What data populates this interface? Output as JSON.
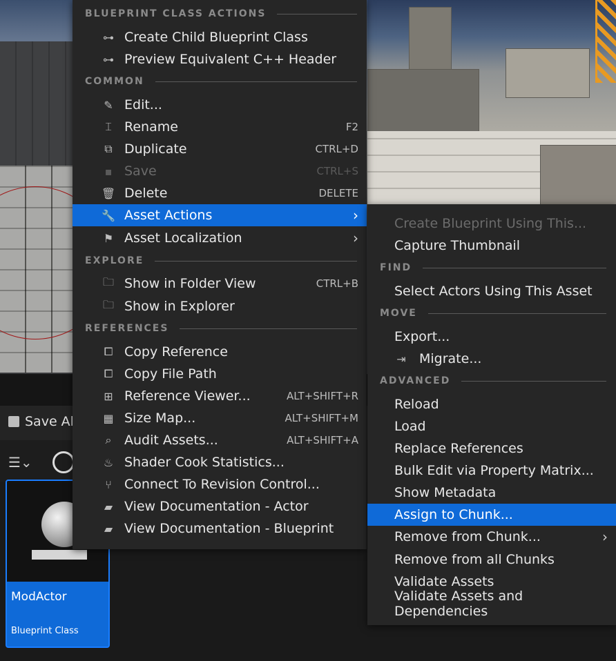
{
  "main_menu": {
    "sections": [
      {
        "title": "BLUEPRINT CLASS ACTIONS"
      },
      {
        "title": "COMMON"
      },
      {
        "title": "EXPLORE"
      },
      {
        "title": "REFERENCES"
      }
    ],
    "items": [
      {
        "label": "Create Child Blueprint Class",
        "shortcut": "",
        "icon": "blueprint-hierarchy-icon"
      },
      {
        "label": "Preview Equivalent C++ Header",
        "shortcut": "",
        "icon": "cpp-header-icon"
      },
      {
        "label": "Edit...",
        "shortcut": "",
        "icon": "pencil-icon"
      },
      {
        "label": "Rename",
        "shortcut": "F2",
        "icon": "rename-icon"
      },
      {
        "label": "Duplicate",
        "shortcut": "CTRL+D",
        "icon": "duplicate-icon"
      },
      {
        "label": "Save",
        "shortcut": "CTRL+S",
        "icon": "save-icon"
      },
      {
        "label": "Delete",
        "shortcut": "DELETE",
        "icon": "trash-icon"
      },
      {
        "label": "Asset Actions",
        "shortcut": "",
        "icon": "wrench-icon"
      },
      {
        "label": "Asset Localization",
        "shortcut": "",
        "icon": "flag-icon"
      },
      {
        "label": "Show in Folder View",
        "shortcut": "CTRL+B",
        "icon": "folder-search-icon"
      },
      {
        "label": "Show in Explorer",
        "shortcut": "",
        "icon": "folder-search-icon"
      },
      {
        "label": "Copy Reference",
        "shortcut": "",
        "icon": "copy-icon"
      },
      {
        "label": "Copy File Path",
        "shortcut": "",
        "icon": "copy-icon"
      },
      {
        "label": "Reference Viewer...",
        "shortcut": "ALT+SHIFT+R",
        "icon": "reference-viewer-icon"
      },
      {
        "label": "Size Map...",
        "shortcut": "ALT+SHIFT+M",
        "icon": "size-map-icon"
      },
      {
        "label": "Audit Assets...",
        "shortcut": "ALT+SHIFT+A",
        "icon": "audit-icon"
      },
      {
        "label": "Shader Cook Statistics...",
        "shortcut": "",
        "icon": "steam-icon"
      },
      {
        "label": "Connect To Revision Control...",
        "shortcut": "",
        "icon": "branch-icon"
      },
      {
        "label": "View Documentation - Actor",
        "shortcut": "",
        "icon": "book-icon"
      },
      {
        "label": "View Documentation - Blueprint",
        "shortcut": "",
        "icon": "book-icon"
      }
    ]
  },
  "sub_menu": {
    "sections": [
      {
        "title": "FIND"
      },
      {
        "title": "MOVE"
      },
      {
        "title": "ADVANCED"
      }
    ],
    "items": [
      {
        "label": "Create Blueprint Using This..."
      },
      {
        "label": "Capture Thumbnail"
      },
      {
        "label": "Select Actors Using This Asset"
      },
      {
        "label": "Export..."
      },
      {
        "label": "Migrate...",
        "icon": "migrate-icon"
      },
      {
        "label": "Reload"
      },
      {
        "label": "Load"
      },
      {
        "label": "Replace References"
      },
      {
        "label": "Bulk Edit via Property Matrix..."
      },
      {
        "label": "Show Metadata"
      },
      {
        "label": "Assign to Chunk..."
      },
      {
        "label": "Remove from Chunk..."
      },
      {
        "label": "Remove from all Chunks"
      },
      {
        "label": "Validate Assets"
      },
      {
        "label": "Validate Assets and Dependencies"
      }
    ]
  },
  "content_browser": {
    "save_all_label": "Save Al",
    "asset": {
      "name": "ModActor",
      "type": "Blueprint Class"
    }
  },
  "colors": {
    "highlight": "#0f6ad8",
    "menu_bg": "#262626"
  }
}
